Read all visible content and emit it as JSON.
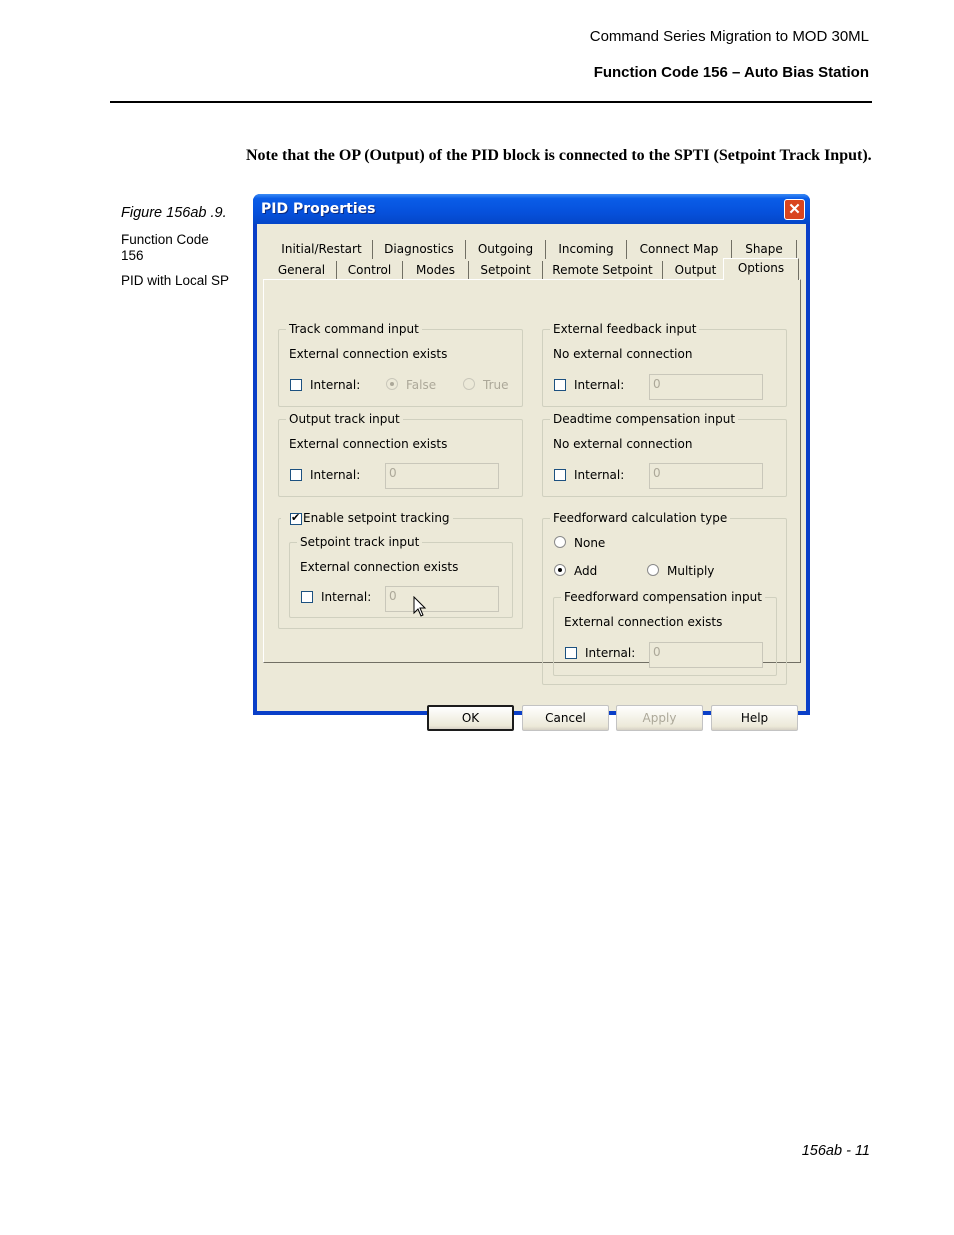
{
  "header": {
    "doc_title": "Command Series Migration to MOD 30ML",
    "section_title": "Function Code 156 – Auto Bias Station"
  },
  "note": "Note that the OP (Output) of the PID block is connected to the SPTI (Setpoint Track Input).",
  "sidebar": {
    "figure_caption": "Figure 156ab .9.",
    "function_code": "Function Code 156",
    "description": "PID with Local SP"
  },
  "dialog": {
    "title": "PID Properties",
    "close_icon": "close-icon",
    "tabs_row1": [
      "Initial/Restart",
      "Diagnostics",
      "Outgoing",
      "Incoming",
      "Connect Map",
      "Shape"
    ],
    "tabs_row2": [
      "General",
      "Control",
      "Modes",
      "Setpoint",
      "Remote Setpoint",
      "Output",
      "Options"
    ],
    "active_tab": "Options",
    "groups": {
      "track_command": {
        "legend": "Track command input",
        "status": "External connection exists",
        "internal_label": "Internal:",
        "internal_checked": false,
        "radio_false": "False",
        "radio_true": "True",
        "selected": "False"
      },
      "external_feedback": {
        "legend": "External feedback input",
        "status": "No external connection",
        "internal_label": "Internal:",
        "internal_checked": false,
        "value": "0"
      },
      "output_track": {
        "legend": "Output track input",
        "status": "External connection exists",
        "internal_label": "Internal:",
        "internal_checked": false,
        "value": "0"
      },
      "deadtime": {
        "legend": "Deadtime compensation input",
        "status": "No external connection",
        "internal_label": "Internal:",
        "internal_checked": false,
        "value": "0"
      },
      "setpoint_tracking": {
        "enable_label": "Enable setpoint tracking",
        "enable_checked": true,
        "sub_legend": "Setpoint track input",
        "status": "External connection exists",
        "internal_label": "Internal:",
        "internal_checked": false,
        "value": "0"
      },
      "feedforward": {
        "legend": "Feedforward calculation type",
        "options": [
          "None",
          "Add",
          "Multiply"
        ],
        "selected": "Add",
        "comp_legend": "Feedforward compensation input",
        "comp_status": "External connection exists",
        "internal_label": "Internal:",
        "internal_checked": false,
        "value": "0"
      }
    },
    "buttons": {
      "ok": "OK",
      "cancel": "Cancel",
      "apply": "Apply",
      "help": "Help"
    }
  },
  "footer": {
    "page_number": "156ab - 11"
  }
}
